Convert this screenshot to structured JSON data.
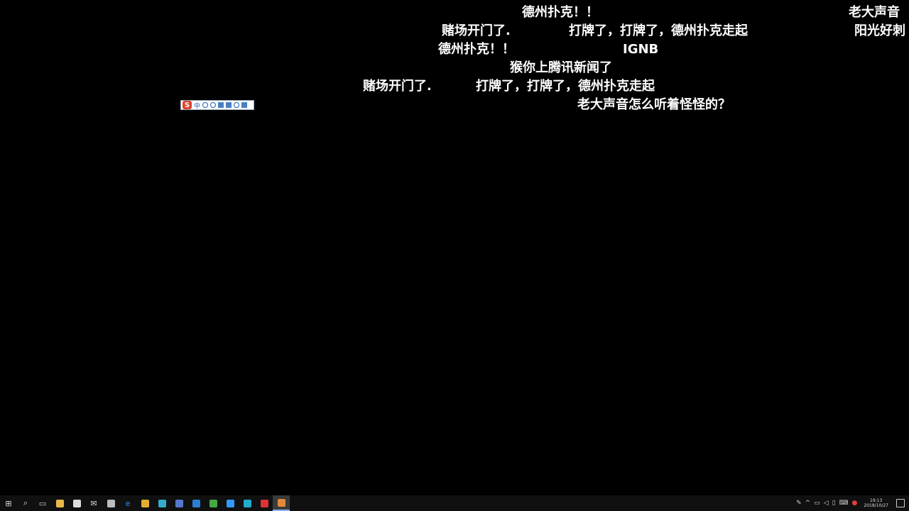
{
  "danmaku": [
    "德州扑克！！",
    "老大声音",
    "赌场开门了.",
    "打牌了，打牌了，德州扑克走起",
    "阳光好刺",
    "德州扑克！！",
    "IGNB",
    "猴你上腾讯新闻了",
    "赌场开门了.",
    "打牌了，打牌了，德州扑克走起",
    "老大声音怎么听着怪怪的？"
  ],
  "ime_toolbar": {
    "logo": "S",
    "mode": "中",
    "icons": [
      "punctuation-icon",
      "emoji-icon",
      "voice-icon",
      "keyboard-icon",
      "skin-icon",
      "toolbox-icon"
    ]
  },
  "taskbar": {
    "start_glyph": "⊞",
    "search_glyph": "⌕",
    "apps": [
      {
        "name": "task-view-icon",
        "glyph": "▭",
        "color": "#cccccc"
      },
      {
        "name": "file-explorer-icon",
        "glyph": "",
        "color": "#e8b84a"
      },
      {
        "name": "store-icon",
        "glyph": "",
        "color": "#dddddd"
      },
      {
        "name": "mail-icon",
        "glyph": "✉",
        "color": "#dddddd"
      },
      {
        "name": "app-icon-1",
        "glyph": "",
        "color": "#bbbbbb"
      },
      {
        "name": "edge-icon",
        "glyph": "e",
        "color": "#3a8ee6"
      },
      {
        "name": "chrome-icon",
        "glyph": "",
        "color": "#e0b030"
      },
      {
        "name": "app-icon-2",
        "glyph": "",
        "color": "#33aacc"
      },
      {
        "name": "app-icon-3",
        "glyph": "",
        "color": "#5577cc"
      },
      {
        "name": "browser-icon",
        "glyph": "",
        "color": "#2a7fd4"
      },
      {
        "name": "terminal-icon",
        "glyph": "",
        "color": "#44aa44"
      },
      {
        "name": "app-icon-4",
        "glyph": "",
        "color": "#3399ff"
      },
      {
        "name": "app-icon-5",
        "glyph": "",
        "color": "#22aacc"
      },
      {
        "name": "app-icon-6",
        "glyph": "",
        "color": "#dd3333"
      },
      {
        "name": "app-icon-7",
        "glyph": "",
        "color": "#e08a3a"
      }
    ],
    "tray_icons": [
      "pen-icon",
      "chevron-up-icon",
      "network-icon",
      "volume-icon",
      "battery-icon",
      "input-icon",
      "antivirus-icon"
    ],
    "clock_time": "19:13",
    "clock_date": "2018/10/27"
  },
  "colors": {
    "background": "#000000",
    "danmaku_text": "#ffffff",
    "taskbar": "#101010"
  }
}
